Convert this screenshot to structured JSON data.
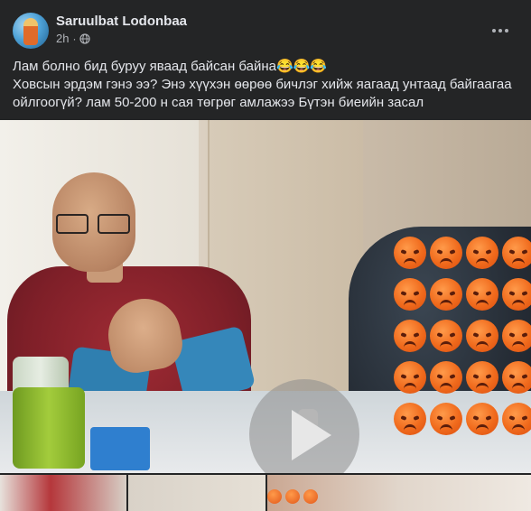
{
  "post": {
    "author": "Saruulbat Lodonbaa",
    "time": "2h",
    "separator": "·",
    "privacy_icon": "globe-icon",
    "more_icon": "more-horizontal-icon",
    "text_lines": [
      "Лам болно бид буруу яваад байсан байна😂😂😂",
      "Ховсын эрдэм гэнэ ээ? Энэ хүүхэн өөрөө бичлэг хийж яагаад унтаад байгаагаа",
      "ойлгоогүй? лам 50-200 н сая төгрөг амлажээ Бүтэн биеийн засал"
    ]
  },
  "media": {
    "type": "video",
    "play_icon": "play-icon",
    "overlay_emoji": "angry-face-emoji",
    "overlay_emoji_count": 20,
    "thumbnail_emoji_count": 3
  },
  "colors": {
    "background": "#242526",
    "text_primary": "#e4e6eb",
    "text_secondary": "#b0b3b8"
  }
}
